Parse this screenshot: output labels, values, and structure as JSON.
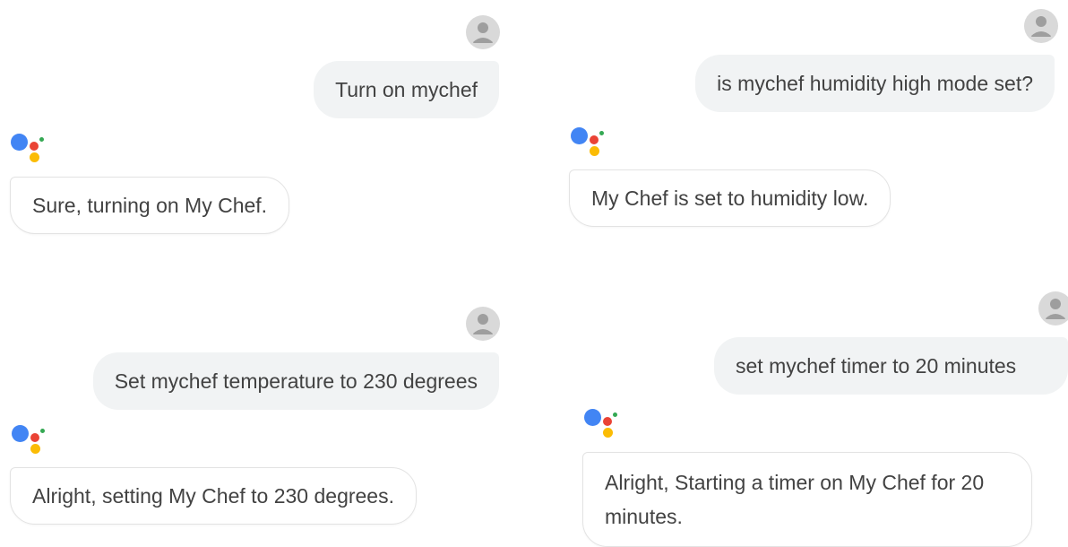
{
  "conversations": [
    {
      "user_message": "Turn on mychef",
      "assistant_reply": "Sure, turning on My Chef."
    },
    {
      "user_message": "is mychef humidity high mode set?",
      "assistant_reply": "My Chef is set to humidity low."
    },
    {
      "user_message": "Set mychef temperature to 230 degrees",
      "assistant_reply": "Alright, setting My Chef to 230 degrees."
    },
    {
      "user_message": "set mychef timer to 20 minutes",
      "assistant_reply": "Alright, Starting a timer on My Chef for 20 minutes."
    }
  ],
  "colors": {
    "assistant_blue": "#4285F4",
    "assistant_red": "#EA4335",
    "assistant_yellow": "#FBBC05",
    "assistant_green": "#34A853",
    "user_bubble": "#f1f3f4",
    "avatar_gray": "#d9d9d9"
  },
  "icons": {
    "user_avatar": "person-icon",
    "assistant_logo": "google-assistant-icon"
  }
}
